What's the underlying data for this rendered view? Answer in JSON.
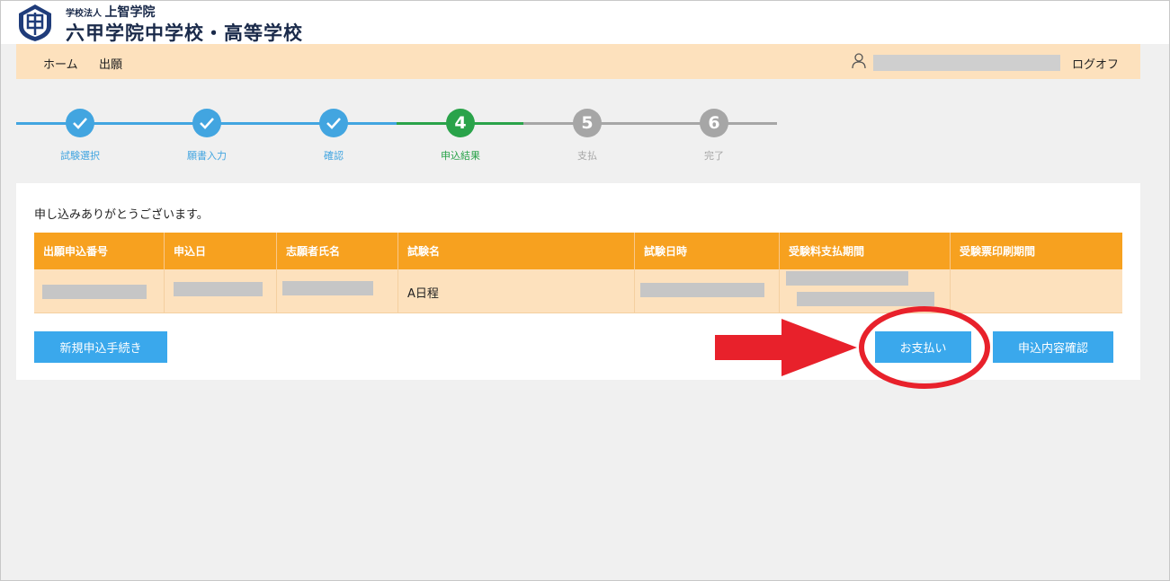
{
  "header": {
    "corp_small": "学校法人",
    "corp_name": "上智学院",
    "school_name": "六甲学院中学校・高等学校"
  },
  "nav": {
    "items": [
      {
        "label": "ホーム"
      },
      {
        "label": "出願"
      }
    ],
    "logoff_label": "ログオフ"
  },
  "colors": {
    "completed": "#42a5e0",
    "current": "#2aa34a",
    "pending": "#a6a6a6",
    "table_header": "#f7a11f",
    "table_row": "#fde1bd",
    "button": "#3aa8ec",
    "annotation": "#e8212b"
  },
  "steps": [
    {
      "number": "",
      "label": "試験選択",
      "state": "done"
    },
    {
      "number": "",
      "label": "願書入力",
      "state": "done"
    },
    {
      "number": "",
      "label": "確認",
      "state": "done"
    },
    {
      "number": "4",
      "label": "申込結果",
      "state": "current"
    },
    {
      "number": "5",
      "label": "支払",
      "state": "pending"
    },
    {
      "number": "6",
      "label": "完了",
      "state": "pending"
    }
  ],
  "main": {
    "thanks_message": "申し込みありがとうございます。",
    "table": {
      "columns": [
        "出願申込番号",
        "申込日",
        "志願者氏名",
        "試験名",
        "試験日時",
        "受験料支払期間",
        "受験票印刷期間"
      ],
      "rows": [
        [
          "",
          "",
          "",
          "A日程",
          "",
          "",
          ""
        ]
      ]
    },
    "buttons": {
      "new_application": "新規申込手続き",
      "pay": "お支払い",
      "confirm": "申込内容確認"
    }
  }
}
